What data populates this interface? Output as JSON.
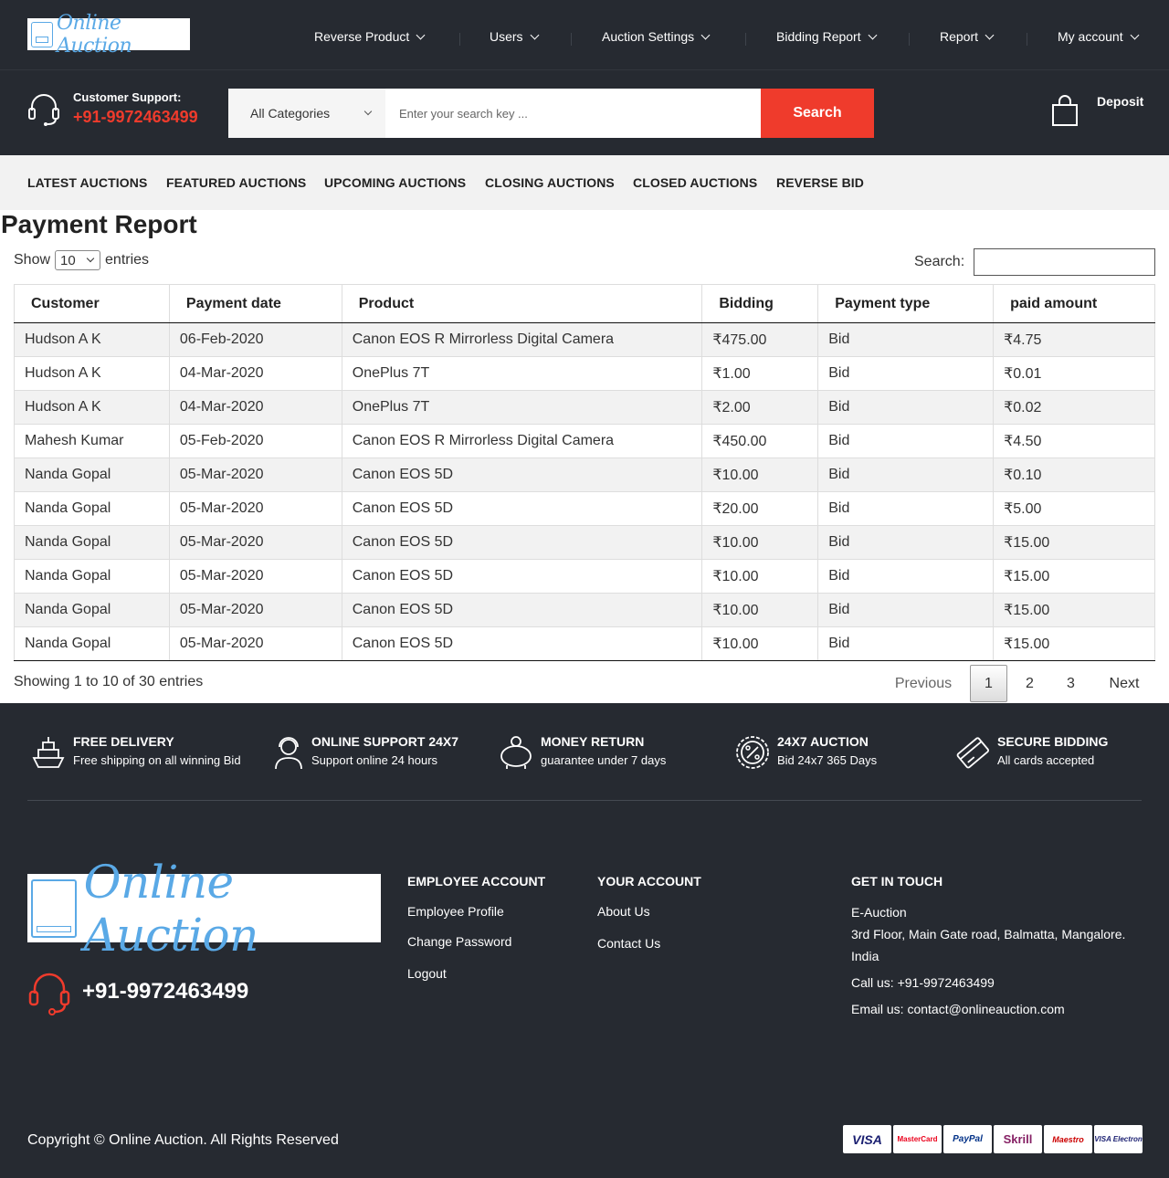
{
  "brand": {
    "logo_text": "Online Auction"
  },
  "nav": {
    "items": [
      {
        "label": "Reverse Product"
      },
      {
        "label": "Users"
      },
      {
        "label": "Auction Settings"
      },
      {
        "label": "Bidding Report"
      },
      {
        "label": "Report"
      },
      {
        "label": "My account"
      }
    ]
  },
  "support": {
    "label": "Customer Support:",
    "phone": "+91-9972463499"
  },
  "search": {
    "category": "All Categories",
    "placeholder": "Enter your search key ...",
    "button": "Search"
  },
  "deposit": {
    "label": "Deposit"
  },
  "categories": [
    "LATEST AUCTIONS",
    "FEATURED AUCTIONS",
    "UPCOMING AUCTIONS",
    "CLOSING AUCTIONS",
    "CLOSED AUCTIONS",
    "REVERSE BID"
  ],
  "report": {
    "title": "Payment Report",
    "show_label": "Show",
    "entries_value": "10",
    "entries_label": "entries",
    "search_label": "Search:",
    "columns": [
      "Customer",
      "Payment date",
      "Product",
      "Bidding",
      "Payment type",
      "paid amount"
    ],
    "rows": [
      [
        "Hudson A K",
        "06-Feb-2020",
        "Canon EOS R Mirrorless Digital Camera",
        "₹475.00",
        "Bid",
        "₹4.75"
      ],
      [
        "Hudson A K",
        "04-Mar-2020",
        "OnePlus 7T",
        "₹1.00",
        "Bid",
        "₹0.01"
      ],
      [
        "Hudson A K",
        "04-Mar-2020",
        "OnePlus 7T",
        "₹2.00",
        "Bid",
        "₹0.02"
      ],
      [
        "Mahesh Kumar",
        "05-Feb-2020",
        "Canon EOS R Mirrorless Digital Camera",
        "₹450.00",
        "Bid",
        "₹4.50"
      ],
      [
        "Nanda Gopal",
        "05-Mar-2020",
        "Canon EOS 5D",
        "₹10.00",
        "Bid",
        "₹0.10"
      ],
      [
        "Nanda Gopal",
        "05-Mar-2020",
        "Canon EOS 5D",
        "₹20.00",
        "Bid",
        "₹5.00"
      ],
      [
        "Nanda Gopal",
        "05-Mar-2020",
        "Canon EOS 5D",
        "₹10.00",
        "Bid",
        "₹15.00"
      ],
      [
        "Nanda Gopal",
        "05-Mar-2020",
        "Canon EOS 5D",
        "₹10.00",
        "Bid",
        "₹15.00"
      ],
      [
        "Nanda Gopal",
        "05-Mar-2020",
        "Canon EOS 5D",
        "₹10.00",
        "Bid",
        "₹15.00"
      ],
      [
        "Nanda Gopal",
        "05-Mar-2020",
        "Canon EOS 5D",
        "₹10.00",
        "Bid",
        "₹15.00"
      ]
    ],
    "info": "Showing 1 to 10 of 30 entries",
    "pager": {
      "previous": "Previous",
      "pages": [
        "1",
        "2",
        "3"
      ],
      "current": "1",
      "next": "Next"
    }
  },
  "features": [
    {
      "icon": "ship-icon",
      "title": "FREE DELIVERY",
      "subtitle": "Free shipping on all winning Bid"
    },
    {
      "icon": "support-agent-icon",
      "title": "ONLINE SUPPORT 24X7",
      "subtitle": "Support online 24 hours"
    },
    {
      "icon": "piggy-bank-icon",
      "title": "MONEY RETURN",
      "subtitle": "guarantee under 7 days"
    },
    {
      "icon": "percent-badge-icon",
      "title": "24X7 AUCTION",
      "subtitle": "Bid 24x7 365 Days"
    },
    {
      "icon": "credit-card-icon",
      "title": "SECURE BIDDING",
      "subtitle": "All cards accepted"
    }
  ],
  "footer": {
    "phone": "+91-9972463499",
    "employee": {
      "title": "EMPLOYEE ACCOUNT",
      "links": [
        "Employee Profile",
        "Change Password",
        "Logout"
      ]
    },
    "account": {
      "title": "YOUR ACCOUNT",
      "links": [
        "About Us",
        "Contact Us"
      ]
    },
    "contact": {
      "title": "GET IN TOUCH",
      "name": "E-Auction",
      "address_1": "3rd Floor, Main Gate road, Balmatta, Mangalore.",
      "address_2": "India",
      "call": "Call us: +91-9972463499",
      "email": "Email us: contact@onlineauction.com"
    },
    "copyright": "Copyright © Online Auction. All Rights Reserved",
    "payments": [
      {
        "label": "VISA",
        "color": "#1a1f71"
      },
      {
        "label": "MasterCard",
        "color": "#eb001b"
      },
      {
        "label": "PayPal",
        "color": "#003087"
      },
      {
        "label": "Skrill",
        "color": "#862165"
      },
      {
        "label": "Maestro",
        "color": "#cc0000"
      },
      {
        "label": "VISA Electron",
        "color": "#1a1f71"
      }
    ]
  },
  "colors": {
    "dark": "#262a31",
    "accent": "#ef3b2c",
    "logo": "#5aa9e6"
  }
}
